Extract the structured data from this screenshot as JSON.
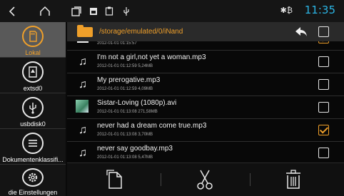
{
  "status_bar": {
    "icons": [
      "back-icon",
      "home-icon",
      "recent-apps-icon",
      "screenshot-icon",
      "clipboard-icon",
      "usb-icon"
    ],
    "bluetooth_text": "✱₿",
    "time": "11:35"
  },
  "sidebar": {
    "items": [
      {
        "label": "Lokal",
        "icon": "sd-card-icon"
      },
      {
        "label": "extsd0",
        "icon": "external-sd-icon"
      },
      {
        "label": "usbdisk0",
        "icon": "usb-icon"
      },
      {
        "label": "Dokumentenklassifi...",
        "icon": "list-icon"
      },
      {
        "label": "die Einstellungen",
        "icon": "gear-icon"
      }
    ]
  },
  "path_bar": {
    "path": "/storage/emulated/0/iNand"
  },
  "files": [
    {
      "name": "",
      "meta": "2012-01-01 01:15:57",
      "type": "partial",
      "checked": true
    },
    {
      "name": "I'm not a girl,not yet a woman.mp3",
      "meta": "2012-01-01 01:12:59  5,24MB",
      "type": "music",
      "checked": false
    },
    {
      "name": "My prerogative.mp3",
      "meta": "2012-01-01 01:12:59  4,09MB",
      "type": "music",
      "checked": false
    },
    {
      "name": "Sistar-Loving (1080p).avi",
      "meta": "2012-01-01 01:13:08  271,58MB",
      "type": "video",
      "checked": false
    },
    {
      "name": "never had a dream come true.mp3",
      "meta": "2012-01-01 01:13:08  3,70MB",
      "type": "music",
      "checked": true
    },
    {
      "name": "never say goodbay.mp3",
      "meta": "2012-01-01 01:13:08  5,47MB",
      "type": "music",
      "checked": false
    }
  ],
  "toolbar": {
    "buttons": [
      "copy-icon",
      "cut-icon",
      "delete-icon"
    ]
  },
  "colors": {
    "accent": "#f0a02a",
    "time": "#2bb5e5",
    "selected_sidebar": "#595959"
  }
}
